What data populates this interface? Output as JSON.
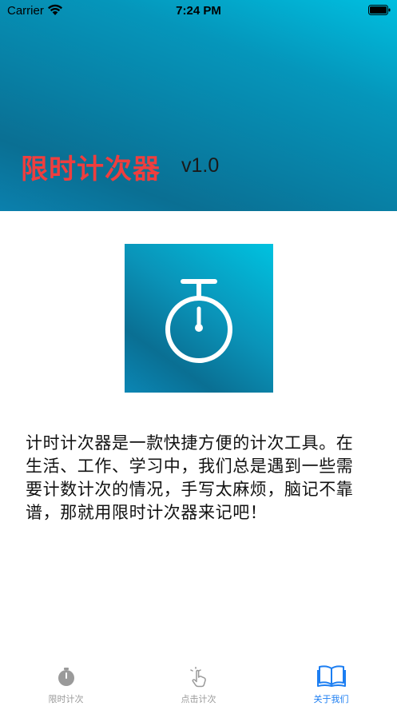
{
  "status_bar": {
    "carrier": "Carrier",
    "time": "7:24 PM"
  },
  "header": {
    "title": "限时计次器",
    "version": "v1.0"
  },
  "logo": {
    "icon": "stopwatch-icon"
  },
  "description": "计时计次器是一款快捷方便的计次工具。在生活、工作、学习中，我们总是遇到一些需要计数计次的情况，手写太麻烦，脑记不靠谱，那就用限时计次器来记吧！",
  "tab_bar": {
    "tabs": [
      {
        "label": "限时计次",
        "icon": "timer-icon",
        "active": false
      },
      {
        "label": "点击计次",
        "icon": "tap-hand-icon",
        "active": false
      },
      {
        "label": "关于我们",
        "icon": "open-book-icon",
        "active": true
      }
    ]
  },
  "colors": {
    "title_red": "#ef3e3e",
    "gradient_light": "#00bfe0",
    "gradient_dark": "#0a6f93",
    "tab_active": "#1c7ef2",
    "tab_inactive": "#9a9a9a"
  }
}
